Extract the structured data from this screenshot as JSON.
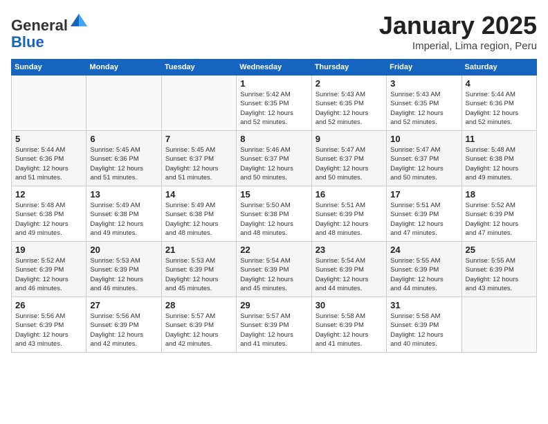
{
  "header": {
    "logo_general": "General",
    "logo_blue": "Blue",
    "title": "January 2025",
    "subtitle": "Imperial, Lima region, Peru"
  },
  "days_of_week": [
    "Sunday",
    "Monday",
    "Tuesday",
    "Wednesday",
    "Thursday",
    "Friday",
    "Saturday"
  ],
  "weeks": [
    [
      {
        "day": "",
        "info": ""
      },
      {
        "day": "",
        "info": ""
      },
      {
        "day": "",
        "info": ""
      },
      {
        "day": "1",
        "info": "Sunrise: 5:42 AM\nSunset: 6:35 PM\nDaylight: 12 hours\nand 52 minutes."
      },
      {
        "day": "2",
        "info": "Sunrise: 5:43 AM\nSunset: 6:35 PM\nDaylight: 12 hours\nand 52 minutes."
      },
      {
        "day": "3",
        "info": "Sunrise: 5:43 AM\nSunset: 6:35 PM\nDaylight: 12 hours\nand 52 minutes."
      },
      {
        "day": "4",
        "info": "Sunrise: 5:44 AM\nSunset: 6:36 PM\nDaylight: 12 hours\nand 52 minutes."
      }
    ],
    [
      {
        "day": "5",
        "info": "Sunrise: 5:44 AM\nSunset: 6:36 PM\nDaylight: 12 hours\nand 51 minutes."
      },
      {
        "day": "6",
        "info": "Sunrise: 5:45 AM\nSunset: 6:36 PM\nDaylight: 12 hours\nand 51 minutes."
      },
      {
        "day": "7",
        "info": "Sunrise: 5:45 AM\nSunset: 6:37 PM\nDaylight: 12 hours\nand 51 minutes."
      },
      {
        "day": "8",
        "info": "Sunrise: 5:46 AM\nSunset: 6:37 PM\nDaylight: 12 hours\nand 50 minutes."
      },
      {
        "day": "9",
        "info": "Sunrise: 5:47 AM\nSunset: 6:37 PM\nDaylight: 12 hours\nand 50 minutes."
      },
      {
        "day": "10",
        "info": "Sunrise: 5:47 AM\nSunset: 6:37 PM\nDaylight: 12 hours\nand 50 minutes."
      },
      {
        "day": "11",
        "info": "Sunrise: 5:48 AM\nSunset: 6:38 PM\nDaylight: 12 hours\nand 49 minutes."
      }
    ],
    [
      {
        "day": "12",
        "info": "Sunrise: 5:48 AM\nSunset: 6:38 PM\nDaylight: 12 hours\nand 49 minutes."
      },
      {
        "day": "13",
        "info": "Sunrise: 5:49 AM\nSunset: 6:38 PM\nDaylight: 12 hours\nand 49 minutes."
      },
      {
        "day": "14",
        "info": "Sunrise: 5:49 AM\nSunset: 6:38 PM\nDaylight: 12 hours\nand 48 minutes."
      },
      {
        "day": "15",
        "info": "Sunrise: 5:50 AM\nSunset: 6:38 PM\nDaylight: 12 hours\nand 48 minutes."
      },
      {
        "day": "16",
        "info": "Sunrise: 5:51 AM\nSunset: 6:39 PM\nDaylight: 12 hours\nand 48 minutes."
      },
      {
        "day": "17",
        "info": "Sunrise: 5:51 AM\nSunset: 6:39 PM\nDaylight: 12 hours\nand 47 minutes."
      },
      {
        "day": "18",
        "info": "Sunrise: 5:52 AM\nSunset: 6:39 PM\nDaylight: 12 hours\nand 47 minutes."
      }
    ],
    [
      {
        "day": "19",
        "info": "Sunrise: 5:52 AM\nSunset: 6:39 PM\nDaylight: 12 hours\nand 46 minutes."
      },
      {
        "day": "20",
        "info": "Sunrise: 5:53 AM\nSunset: 6:39 PM\nDaylight: 12 hours\nand 46 minutes."
      },
      {
        "day": "21",
        "info": "Sunrise: 5:53 AM\nSunset: 6:39 PM\nDaylight: 12 hours\nand 45 minutes."
      },
      {
        "day": "22",
        "info": "Sunrise: 5:54 AM\nSunset: 6:39 PM\nDaylight: 12 hours\nand 45 minutes."
      },
      {
        "day": "23",
        "info": "Sunrise: 5:54 AM\nSunset: 6:39 PM\nDaylight: 12 hours\nand 44 minutes."
      },
      {
        "day": "24",
        "info": "Sunrise: 5:55 AM\nSunset: 6:39 PM\nDaylight: 12 hours\nand 44 minutes."
      },
      {
        "day": "25",
        "info": "Sunrise: 5:55 AM\nSunset: 6:39 PM\nDaylight: 12 hours\nand 43 minutes."
      }
    ],
    [
      {
        "day": "26",
        "info": "Sunrise: 5:56 AM\nSunset: 6:39 PM\nDaylight: 12 hours\nand 43 minutes."
      },
      {
        "day": "27",
        "info": "Sunrise: 5:56 AM\nSunset: 6:39 PM\nDaylight: 12 hours\nand 42 minutes."
      },
      {
        "day": "28",
        "info": "Sunrise: 5:57 AM\nSunset: 6:39 PM\nDaylight: 12 hours\nand 42 minutes."
      },
      {
        "day": "29",
        "info": "Sunrise: 5:57 AM\nSunset: 6:39 PM\nDaylight: 12 hours\nand 41 minutes."
      },
      {
        "day": "30",
        "info": "Sunrise: 5:58 AM\nSunset: 6:39 PM\nDaylight: 12 hours\nand 41 minutes."
      },
      {
        "day": "31",
        "info": "Sunrise: 5:58 AM\nSunset: 6:39 PM\nDaylight: 12 hours\nand 40 minutes."
      },
      {
        "day": "",
        "info": ""
      }
    ]
  ]
}
